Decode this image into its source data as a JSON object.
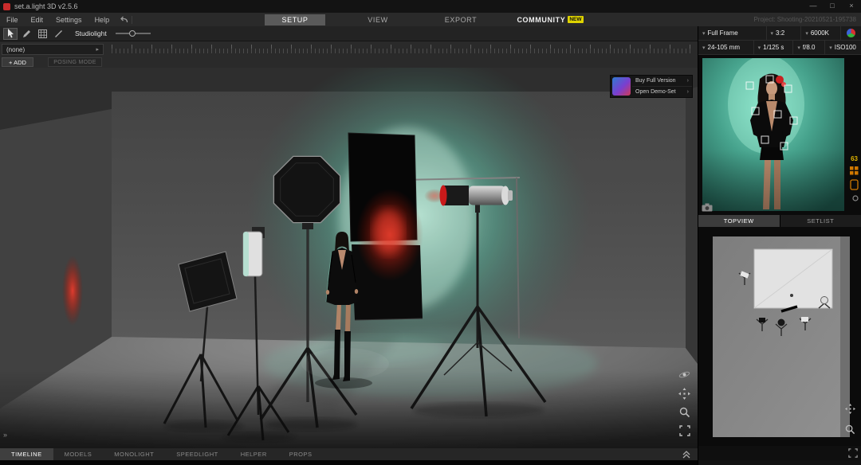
{
  "window": {
    "title": "set.a.light 3D v2.5.6",
    "project_label": "Project: Shooting-20210521-195738",
    "minimize_glyph": "—",
    "maximize_glyph": "□",
    "close_glyph": "×"
  },
  "menubar": {
    "items": [
      "File",
      "Edit",
      "Settings",
      "Help"
    ]
  },
  "main_tabs": {
    "setup": "SETUP",
    "view": "VIEW",
    "export": "EXPORT",
    "community": "COMMUNITY",
    "community_badge": "NEW"
  },
  "toolbar": {
    "mode_label": "Studiolight"
  },
  "left_panel": {
    "preset_value": "(none)",
    "add_label": "+ ADD",
    "posing_label": "POSING MODE"
  },
  "viewport": {
    "buy_label": "Buy Full Version",
    "demo_label": "Open Demo-Set",
    "collapse_glyph": "»"
  },
  "camera": {
    "format": "Full Frame",
    "ratio": "3:2",
    "white_balance": "6000K",
    "lens": "24-105 mm",
    "shutter": "1/125 s",
    "aperture": "f/8.0",
    "iso": "ISO100",
    "meter_value": "63"
  },
  "right_tabs": {
    "topview": "TOPVIEW",
    "setlist": "SETLIST"
  },
  "bottom_tabs": [
    "TIMELINE",
    "MODELS",
    "MONOLIGHT",
    "SPEEDLIGHT",
    "HELPER",
    "PROPS"
  ],
  "glyphs": {
    "caret_down": "▾",
    "caret_right": "▸",
    "arrow_right": "›"
  },
  "colors": {
    "accent_teal": "#5fcdb4",
    "accent_red": "#d42414",
    "badge_yellow": "#ded300",
    "meter_yellow": "#e0b400",
    "icon_orange": "#d07800"
  }
}
